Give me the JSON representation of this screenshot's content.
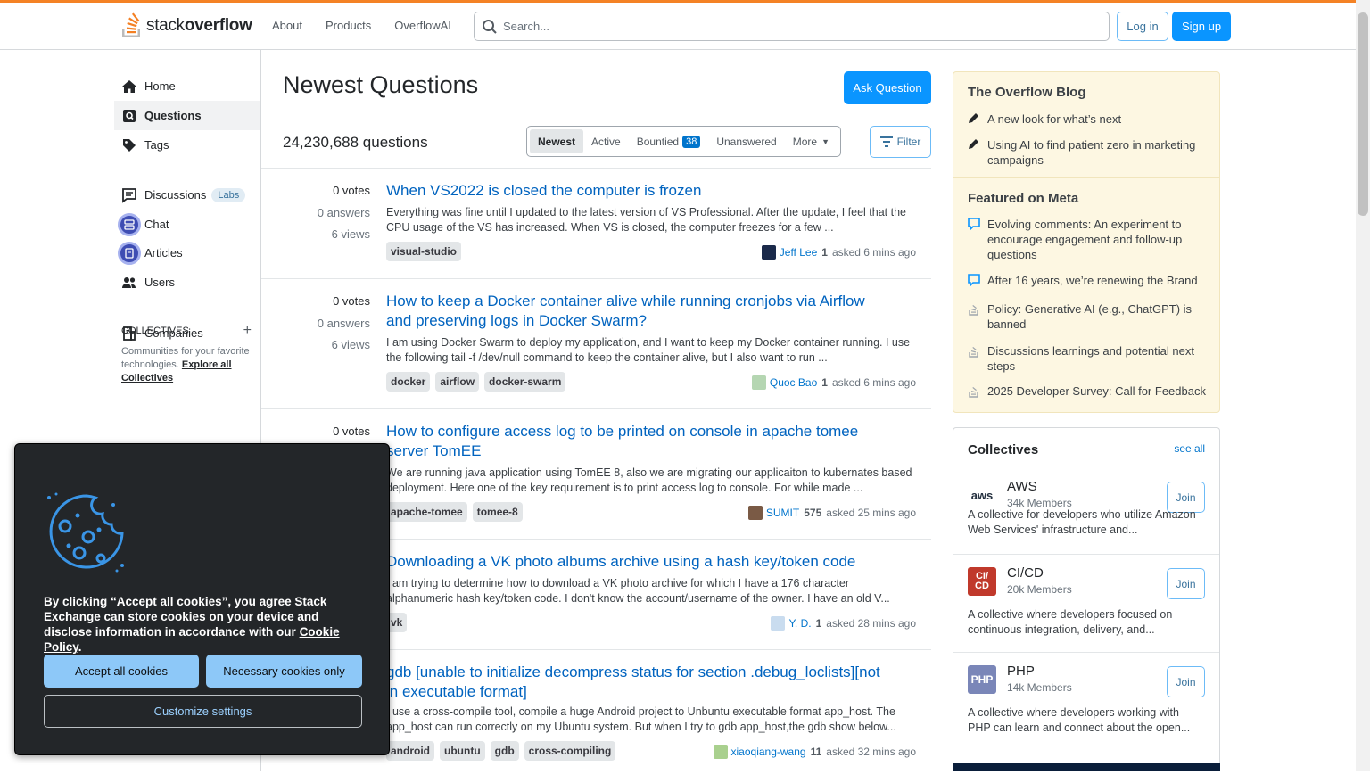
{
  "header": {
    "logo_text_a": "stack",
    "logo_text_b": "overflow",
    "nav": [
      "About",
      "Products",
      "OverflowAI"
    ],
    "search_placeholder": "Search...",
    "login": "Log in",
    "signup": "Sign up",
    "accent_color": "#f48225"
  },
  "sidebar": {
    "items": [
      {
        "label": "Home",
        "icon": "home-icon"
      },
      {
        "label": "Questions",
        "icon": "questions-icon"
      },
      {
        "label": "Tags",
        "icon": "tag-icon"
      },
      {
        "label": "Discussions",
        "icon": "discussions-icon",
        "badge": "Labs"
      },
      {
        "label": "Chat",
        "icon": "chat-icon"
      },
      {
        "label": "Articles",
        "icon": "articles-icon"
      },
      {
        "label": "Users",
        "icon": "users-icon"
      },
      {
        "label": "Companies",
        "icon": "companies-icon"
      }
    ],
    "collectives_heading": "COLLECTIVES",
    "collectives_text": "Communities for your favorite technologies.",
    "collectives_link": "Explore all Collectives"
  },
  "main": {
    "title": "Newest Questions",
    "ask_button": "Ask Question",
    "count": "24,230,688 questions",
    "tabs": [
      "Newest",
      "Active",
      "Bountied",
      "Unanswered",
      "More"
    ],
    "bountied_badge": "38",
    "filter": "Filter",
    "questions": [
      {
        "votes": "0 votes",
        "answers": "0 answers",
        "views": "6 views",
        "title": "When VS2022 is closed the computer is frozen",
        "excerpt": "Everything was fine until I updated to the latest version of VS Professional. After the update, I feel that the CPU usage of the VS has increased. When VS is closed, the computer freezes for a few ...",
        "tags": [
          "visual-studio"
        ],
        "user": "Jeff Lee",
        "rep": "1",
        "time": "asked 6 mins ago"
      },
      {
        "votes": "0 votes",
        "answers": "0 answers",
        "views": "6 views",
        "title": "How to keep a Docker container alive while running cronjobs via Airflow and preserving logs in Docker Swarm?",
        "excerpt": "I am using Docker Swarm to deploy my application, and I want to keep my Docker container running. I use the following tail -f /dev/null command to keep the container alive, but I also want to run ...",
        "tags": [
          "docker",
          "airflow",
          "docker-swarm"
        ],
        "user": "Quoc Bao",
        "rep": "1",
        "time": "asked 6 mins ago"
      },
      {
        "votes": "0 votes",
        "answers": "",
        "views": "",
        "title": "How to configure access log to be printed on console in apache tomee server TomEE",
        "excerpt": "We are running java application using TomEE 8, also we are migrating our applicaiton to kubernates based deployment. Here one of the key requirement is to print access log to console. For while made ...",
        "tags": [
          "apache-tomee",
          "tomee-8"
        ],
        "user": "SUMIT",
        "rep": "575",
        "time": "asked 25 mins ago"
      },
      {
        "votes": "",
        "answers": "",
        "views": "",
        "title": "Downloading a VK photo albums archive using a hash key/token code",
        "excerpt": "I am trying to determine how to download a VK photo archive for which I have a 176 character alphanumeric hash key/token code. I don't know the account/username of the owner. I have an old V...",
        "tags": [
          "vk"
        ],
        "user": "Y. D.",
        "rep": "1",
        "time": "asked 28 mins ago"
      },
      {
        "votes": "",
        "answers": "",
        "views": "",
        "title": "gdb [unable to initialize decompress status for section .debug_loclists][not in executable format]",
        "excerpt": "I use a cross-compile tool, compile a huge Android project to Unbuntu executable format app_host. The app_host can run correctly on my Ubuntu system. But when I try to gdb app_host,the gdb show below...",
        "tags": [
          "android",
          "ubuntu",
          "gdb",
          "cross-compiling"
        ],
        "user": "xiaoqiang-wang",
        "rep": "11",
        "time": "asked 32 mins ago"
      }
    ]
  },
  "right": {
    "blog_heading": "The Overflow Blog",
    "blog_items": [
      "A new look for what’s next",
      "Using AI to find patient zero in marketing campaigns"
    ],
    "meta_heading": "Featured on Meta",
    "meta_items": [
      "Evolving comments: An experiment to encourage engagement and follow-up questions",
      "After 16 years, we’re renewing the Brand",
      "Policy: Generative AI (e.g., ChatGPT) is banned",
      "Discussions learnings and potential next steps",
      "2025 Developer Survey: Call for Feedback"
    ],
    "collectives_heading": "Collectives",
    "see_all": "see all",
    "collectives": [
      {
        "name": "AWS",
        "members": "34k Members",
        "desc": "A collective for developers who utilize Amazon Web Services' infrastructure and...",
        "join": "Join",
        "logo": "aws"
      },
      {
        "name": "CI/CD",
        "members": "20k Members",
        "desc": "A collective where developers focused on continuous integration, delivery, and...",
        "join": "Join",
        "logo": "CI/ CD"
      },
      {
        "name": "PHP",
        "members": "14k Members",
        "desc": "A collective where developers working with PHP can learn and connect about the open...",
        "join": "Join",
        "logo": "PHP"
      }
    ]
  },
  "cookie": {
    "text_a": "By clicking “Accept all cookies”, you agree Stack Exchange can store cookies on your device and disclose information in accordance with our ",
    "link": "Cookie Policy",
    "text_b": ".",
    "accept": "Accept all cookies",
    "necessary": "Necessary cookies only",
    "customize": "Customize settings"
  }
}
